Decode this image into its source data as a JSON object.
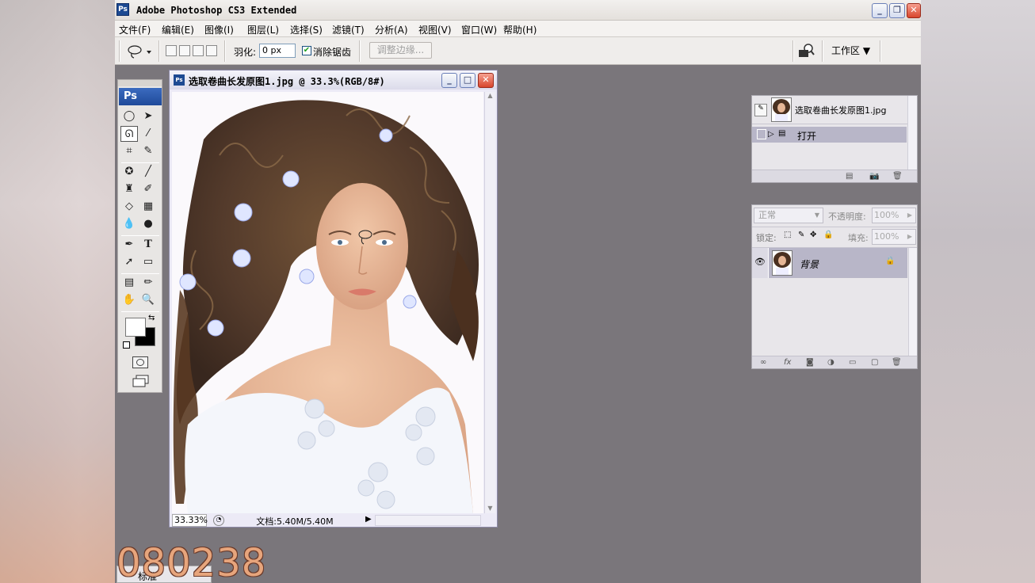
{
  "window": {
    "title": "Adobe Photoshop CS3 Extended",
    "app_icon": "Ps",
    "minimize": "_",
    "restore": "❐",
    "close": "✕"
  },
  "menu": [
    "文件(F)",
    "编辑(E)",
    "图像(I)",
    "图层(L)",
    "选择(S)",
    "滤镜(T)",
    "分析(A)",
    "视图(V)",
    "窗口(W)",
    "帮助(H)"
  ],
  "options": {
    "feather_label": "羽化:",
    "feather_value": "0 px",
    "antialias_label": "消除锯齿",
    "antialias_checked": true,
    "refine_edge": "调整边缘...",
    "bridge_label": "Br",
    "workspace": "工作区 ▼"
  },
  "tools": {
    "logo": "Ps"
  },
  "document": {
    "title": "选取卷曲长发原图1.jpg @ 33.3%(RGB/8#)",
    "zoom": "33.33%",
    "doc_size": "文档:5.40M/5.40M"
  },
  "history": {
    "snapshot_name": "选取卷曲长发原图1.jpg",
    "state": "打开"
  },
  "layers": {
    "blend_mode": "正常",
    "opacity_label": "不透明度:",
    "opacity_value": "100%",
    "lock_label": "锁定:",
    "fill_label": "填充:",
    "fill_value": "100%",
    "layer_name": "背景"
  },
  "taskbar": {
    "item": "标准"
  },
  "watermark": "080238",
  "colors": {
    "workspace_bg": "#7a767b",
    "title_blue": "#1d4a92",
    "selected_row": "#b8b6c8"
  }
}
